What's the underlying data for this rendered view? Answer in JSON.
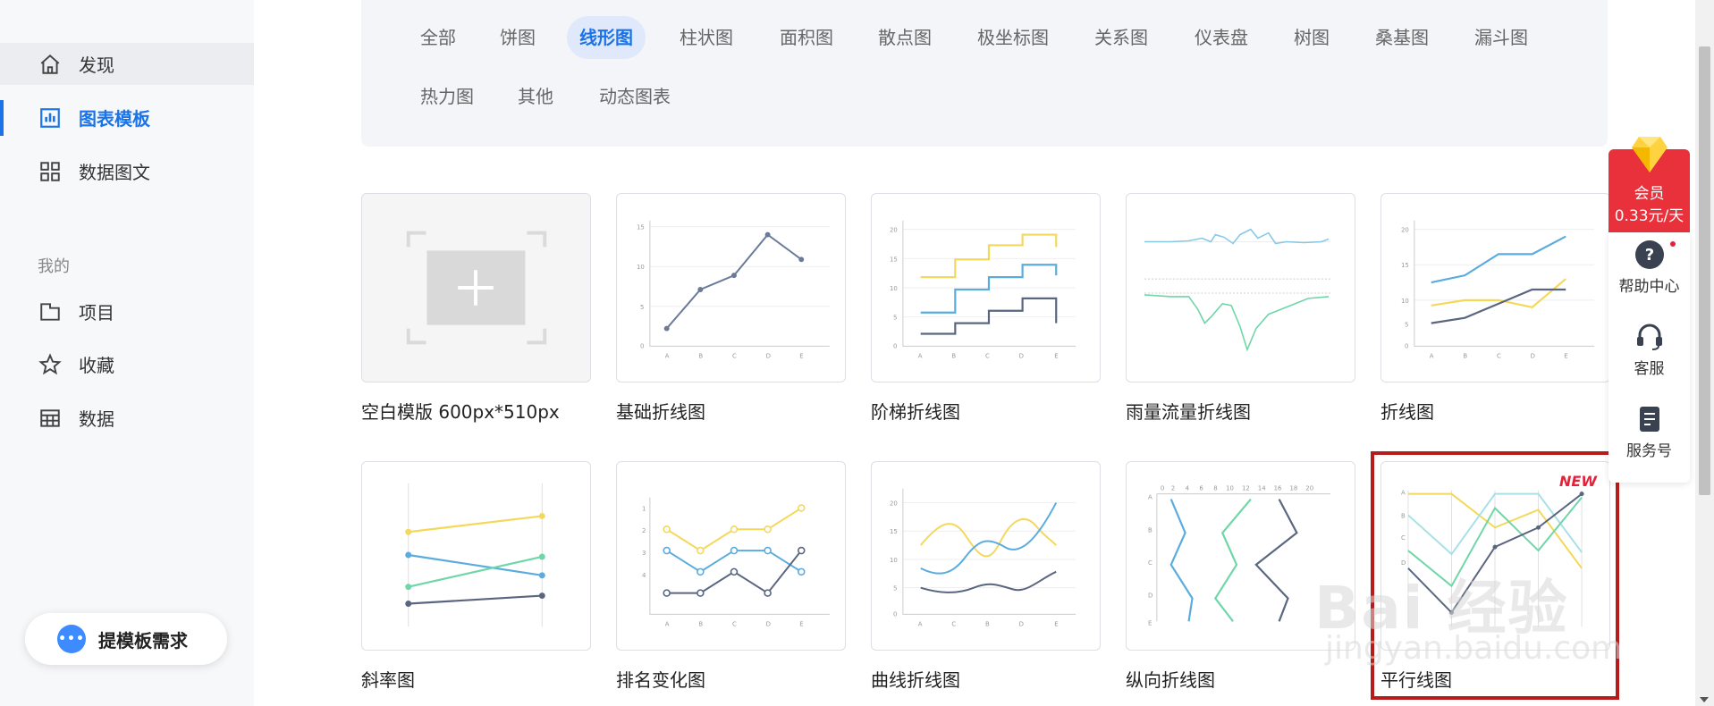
{
  "sidebar": {
    "items": [
      {
        "label": "发现",
        "icon": "home-icon"
      },
      {
        "label": "图表模板",
        "icon": "bar-chart-icon"
      },
      {
        "label": "数据图文",
        "icon": "grid-icon"
      }
    ],
    "section_title": "我的",
    "my_items": [
      {
        "label": "项目",
        "icon": "folder-icon"
      },
      {
        "label": "收藏",
        "icon": "star-icon"
      },
      {
        "label": "数据",
        "icon": "table-icon"
      }
    ],
    "request_button": "提模板需求",
    "accent_color": "#1a73e8"
  },
  "filters": {
    "active": "线形图",
    "tags": [
      "全部",
      "饼图",
      "线形图",
      "柱状图",
      "面积图",
      "散点图",
      "极坐标图",
      "关系图",
      "仪表盘",
      "树图",
      "桑基图",
      "漏斗图",
      "热力图",
      "其他",
      "动态图表"
    ]
  },
  "templates": [
    {
      "title": "空白模版 600px*510px"
    },
    {
      "title": "基础折线图"
    },
    {
      "title": "阶梯折线图"
    },
    {
      "title": "雨量流量折线图"
    },
    {
      "title": "折线图"
    },
    {
      "title": "斜率图"
    },
    {
      "title": "排名变化图"
    },
    {
      "title": "曲线折线图"
    },
    {
      "title": "纵向折线图"
    },
    {
      "title": "平行线图",
      "badge": "NEW"
    }
  ],
  "float": {
    "vip_label": "会员",
    "vip_price": "0.33元/天",
    "help": "帮助中心",
    "service": "客服",
    "account": "服务号"
  },
  "watermark": {
    "main": "Bai 经验",
    "sub": "jingyan.baidu.com"
  }
}
